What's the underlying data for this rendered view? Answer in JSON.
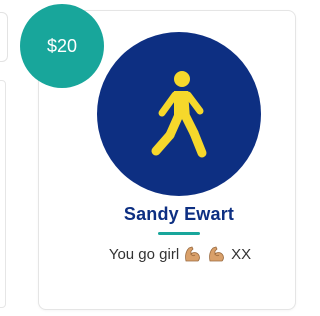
{
  "donation": {
    "amount": "$20",
    "donor_name": "Sandy Ewart",
    "message_text": "You go girl",
    "message_emoji": [
      "flexed-biceps-icon",
      "flexed-biceps-icon"
    ],
    "message_suffix": "XX",
    "avatar_icon": "person-walking-icon"
  },
  "colors": {
    "badge": "#18a69b",
    "avatar_bg": "#0d2f82",
    "avatar_figure": "#f6d82b",
    "name": "#0d2f82",
    "underline": "#18a69b"
  }
}
